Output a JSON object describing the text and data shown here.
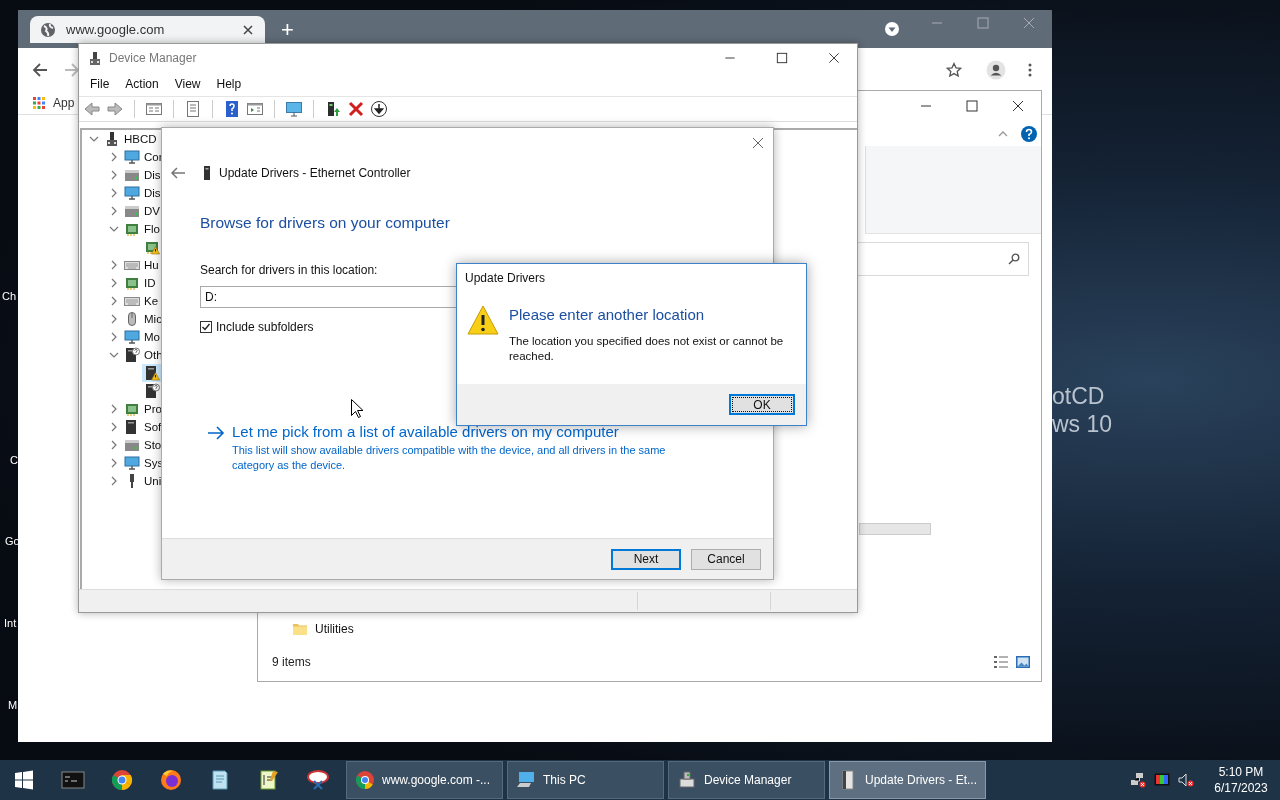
{
  "desktop": {
    "left_labels": [
      "Ch",
      "C",
      "Go",
      "Int",
      "M"
    ],
    "right_labels": [
      "otCD",
      "ws 10"
    ]
  },
  "browser": {
    "tab": {
      "title": "www.google.com"
    },
    "new_tab": "+",
    "bookmarks": [
      {
        "label": "App"
      }
    ]
  },
  "explorer": {
    "items": [
      {
        "label": "Utilities"
      }
    ],
    "status": "9 items"
  },
  "device_manager": {
    "title": "Device Manager",
    "menu": [
      "File",
      "Action",
      "View",
      "Help"
    ],
    "tree": {
      "label": "HBCD",
      "kind": "computer",
      "expanded": true,
      "selected": false,
      "warning": false,
      "unknown": false,
      "children": [
        {
          "label": "Cor",
          "kind": "monitor",
          "expanded": false,
          "selected": false,
          "warning": false,
          "unknown": false
        },
        {
          "label": "Dis",
          "kind": "drive",
          "expanded": false,
          "selected": false,
          "warning": false,
          "unknown": false
        },
        {
          "label": "Dis",
          "kind": "monitor",
          "expanded": false,
          "selected": false,
          "warning": false,
          "unknown": false
        },
        {
          "label": "DV",
          "kind": "drive",
          "expanded": false,
          "selected": false,
          "warning": false,
          "unknown": false
        },
        {
          "label": "Flo",
          "kind": "chip",
          "expanded": true,
          "selected": false,
          "warning": false,
          "unknown": false,
          "children": [
            {
              "kind": "chip",
              "selected": false,
              "warning": true,
              "unknown": false
            }
          ]
        },
        {
          "label": "Hu",
          "kind": "keyboard",
          "expanded": false,
          "selected": false,
          "warning": false,
          "unknown": false
        },
        {
          "label": "ID",
          "kind": "chip",
          "expanded": false,
          "selected": false,
          "warning": false,
          "unknown": false
        },
        {
          "label": "Ke",
          "kind": "keyboard",
          "expanded": false,
          "selected": false,
          "warning": false,
          "unknown": false
        },
        {
          "label": "Mic",
          "kind": "mouse",
          "expanded": false,
          "selected": false,
          "warning": false,
          "unknown": false
        },
        {
          "label": "Mo",
          "kind": "monitor",
          "expanded": false,
          "selected": false,
          "warning": false,
          "unknown": false
        },
        {
          "label": "Oth",
          "kind": "device",
          "expanded": true,
          "selected": false,
          "warning": false,
          "unknown": true,
          "children": [
            {
              "kind": "device",
              "selected": true,
              "warning": true,
              "unknown": false
            },
            {
              "kind": "device",
              "selected": false,
              "warning": false,
              "unknown": true
            }
          ]
        },
        {
          "label": "Pro",
          "kind": "chip",
          "expanded": false,
          "selected": false,
          "warning": false,
          "unknown": false
        },
        {
          "label": "Sof",
          "kind": "device",
          "expanded": false,
          "selected": false,
          "warning": false,
          "unknown": false
        },
        {
          "label": "Sto",
          "kind": "drive",
          "expanded": false,
          "selected": false,
          "warning": false,
          "unknown": false
        },
        {
          "label": "Sys",
          "kind": "monitor",
          "expanded": false,
          "selected": false,
          "warning": false,
          "unknown": false
        },
        {
          "label": "Uni",
          "kind": "usb",
          "expanded": false,
          "selected": false,
          "warning": false,
          "unknown": false
        }
      ]
    }
  },
  "update_dialog": {
    "title": "Update Drivers - Ethernet Controller",
    "heading": "Browse for drivers on your computer",
    "location_label": "Search for drivers in this location:",
    "location_value": "D:",
    "include_subfolders": {
      "label": "Include subfolders",
      "checked": true
    },
    "pick_link": {
      "label": "Let me pick from a list of available drivers on my computer",
      "description": "This list will show available drivers compatible with the device, and all drivers in the same category as the device."
    },
    "buttons": [
      {
        "label": "Next",
        "default": true
      },
      {
        "label": "Cancel",
        "default": false
      }
    ]
  },
  "message_box": {
    "title": "Update Drivers",
    "heading": "Please enter another location",
    "message": "The location you specified does not exist or cannot be reached.",
    "buttons": [
      {
        "label": "OK",
        "default": true
      }
    ]
  },
  "taskbar": {
    "pinned": [
      {
        "kind": "terminal"
      },
      {
        "kind": "chrome"
      },
      {
        "kind": "firefox"
      },
      {
        "kind": "notepad"
      },
      {
        "kind": "editor"
      },
      {
        "kind": "snipping"
      }
    ],
    "tasks": [
      {
        "label": "www.google.com -...",
        "kind": "chrome",
        "selected": false
      },
      {
        "label": "This PC",
        "kind": "computer",
        "selected": false
      },
      {
        "label": "Device Manager",
        "kind": "device_manager",
        "selected": false
      },
      {
        "label": "Update Drivers - Et...",
        "kind": "driver",
        "selected": true
      }
    ],
    "clock": {
      "time": "5:10 PM",
      "date": "6/17/2023"
    }
  }
}
